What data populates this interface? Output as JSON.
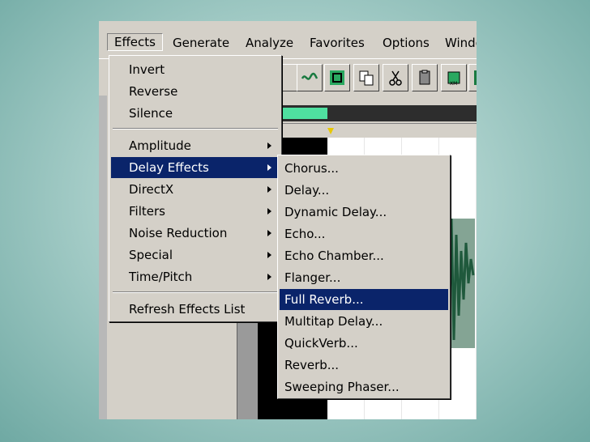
{
  "menubar": {
    "items": [
      {
        "label": "Effects"
      },
      {
        "label": "Generate"
      },
      {
        "label": "Analyze"
      },
      {
        "label": "Favorites"
      },
      {
        "label": "Options"
      },
      {
        "label": "Windo"
      }
    ]
  },
  "effects_menu": {
    "group1": [
      {
        "label": "Invert"
      },
      {
        "label": "Reverse"
      },
      {
        "label": "Silence"
      }
    ],
    "group2": [
      {
        "label": "Amplitude"
      },
      {
        "label": "Delay Effects"
      },
      {
        "label": "DirectX"
      },
      {
        "label": "Filters"
      },
      {
        "label": "Noise Reduction"
      },
      {
        "label": "Special"
      },
      {
        "label": "Time/Pitch"
      }
    ],
    "group3": [
      {
        "label": "Refresh Effects List"
      }
    ],
    "selected": "Delay Effects"
  },
  "delay_submenu": {
    "items": [
      {
        "label": "Chorus..."
      },
      {
        "label": "Delay..."
      },
      {
        "label": "Dynamic Delay..."
      },
      {
        "label": "Echo..."
      },
      {
        "label": "Echo Chamber..."
      },
      {
        "label": "Flanger..."
      },
      {
        "label": "Full Reverb..."
      },
      {
        "label": "Multitap Delay..."
      },
      {
        "label": "QuickVerb..."
      },
      {
        "label": "Reverb..."
      },
      {
        "label": "Sweeping Phaser..."
      }
    ],
    "selected": "Full Reverb..."
  },
  "toolbar": {
    "icons": [
      "wave-icon",
      "crop-icon",
      "copy-icon",
      "cut-icon",
      "paste-icon",
      "mix-paste-icon",
      "green-icon"
    ]
  },
  "colors": {
    "highlight": "#0a246a",
    "menu_bg": "#d4d0c8",
    "waveform": "#1f5a3c",
    "timeline_green": "#4fe0a0"
  }
}
